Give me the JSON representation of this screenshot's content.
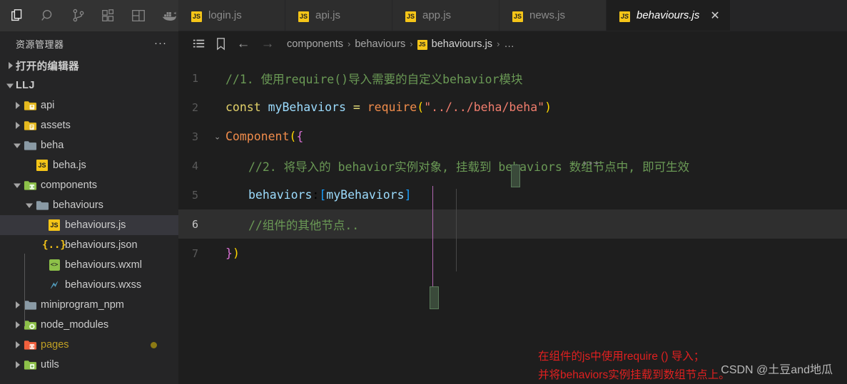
{
  "activity_bar": {
    "items": [
      {
        "name": "explorer-icon",
        "label": "资源管理器",
        "active": true
      },
      {
        "name": "search-icon",
        "label": "搜索",
        "active": false
      },
      {
        "name": "source-control-icon",
        "label": "源代码管理",
        "active": false
      },
      {
        "name": "extensions-icon",
        "label": "扩展",
        "active": false
      },
      {
        "name": "layout-icon",
        "label": "布局",
        "active": false
      },
      {
        "name": "docker-icon",
        "label": "Docker",
        "active": false
      }
    ]
  },
  "sidebar": {
    "title": "资源管理器",
    "more_actions": "···",
    "items": [
      {
        "label": "打开的编辑器",
        "kind": "section",
        "twisty": "collapsed",
        "depth": 0,
        "icon": "none",
        "selected": false
      },
      {
        "label": "LLJ",
        "kind": "section",
        "twisty": "expanded",
        "depth": 0,
        "icon": "none",
        "selected": false
      },
      {
        "label": "api",
        "kind": "folder",
        "twisty": "collapsed",
        "depth": 1,
        "icon": "folder-api",
        "selected": false
      },
      {
        "label": "assets",
        "kind": "folder",
        "twisty": "collapsed",
        "depth": 1,
        "icon": "folder-assets",
        "selected": false
      },
      {
        "label": "beha",
        "kind": "folder",
        "twisty": "expanded",
        "depth": 1,
        "icon": "folder-plain",
        "selected": false
      },
      {
        "label": "beha.js",
        "kind": "file",
        "twisty": "none",
        "depth": 2,
        "icon": "js-icon",
        "selected": false
      },
      {
        "label": "components",
        "kind": "folder",
        "twisty": "expanded",
        "depth": 1,
        "icon": "folder-components",
        "selected": false
      },
      {
        "label": "behaviours",
        "kind": "folder",
        "twisty": "expanded",
        "depth": 2,
        "icon": "folder-plain",
        "selected": false
      },
      {
        "label": "behaviours.js",
        "kind": "file",
        "twisty": "none",
        "depth": 3,
        "icon": "js-icon",
        "selected": true
      },
      {
        "label": "behaviours.json",
        "kind": "file",
        "twisty": "none",
        "depth": 3,
        "icon": "json-icon",
        "selected": false
      },
      {
        "label": "behaviours.wxml",
        "kind": "file",
        "twisty": "none",
        "depth": 3,
        "icon": "wxml-icon",
        "selected": false
      },
      {
        "label": "behaviours.wxss",
        "kind": "file",
        "twisty": "none",
        "depth": 3,
        "icon": "wxss-icon",
        "selected": false
      },
      {
        "label": "miniprogram_npm",
        "kind": "folder",
        "twisty": "collapsed",
        "depth": 1,
        "icon": "folder-grey",
        "selected": false
      },
      {
        "label": "node_modules",
        "kind": "folder",
        "twisty": "collapsed",
        "depth": 1,
        "icon": "folder-node",
        "selected": false
      },
      {
        "label": "pages",
        "kind": "folder",
        "twisty": "collapsed",
        "depth": 1,
        "icon": "folder-pages",
        "selected": false,
        "badge": true,
        "dirty": true
      },
      {
        "label": "utils",
        "kind": "folder",
        "twisty": "collapsed",
        "depth": 1,
        "icon": "folder-utils",
        "selected": false
      }
    ]
  },
  "tabs": [
    {
      "label": "login.js",
      "icon": "js-icon",
      "active": false,
      "closable": false
    },
    {
      "label": "api.js",
      "icon": "js-icon",
      "active": false,
      "closable": false
    },
    {
      "label": "app.js",
      "icon": "js-icon",
      "active": false,
      "closable": false
    },
    {
      "label": "news.js",
      "icon": "js-icon",
      "active": false,
      "closable": false
    },
    {
      "label": "behaviours.js",
      "icon": "js-icon",
      "active": true,
      "closable": true,
      "close_glyph": "✕"
    }
  ],
  "breadcrumb": {
    "toolbar": [
      {
        "name": "outline-icon",
        "glyph": "list"
      },
      {
        "name": "bookmark-icon",
        "glyph": "bookmark"
      }
    ],
    "nav_back": "←",
    "nav_forward": "→",
    "separator": "›",
    "crumbs": [
      {
        "label": "components",
        "icon": "none",
        "lit": false
      },
      {
        "label": "behaviours",
        "icon": "none",
        "lit": false
      },
      {
        "label": "behaviours.js",
        "icon": "js-icon",
        "lit": true
      },
      {
        "label": "…",
        "icon": "none",
        "lit": false
      }
    ]
  },
  "editor": {
    "lines": [
      {
        "n": "1",
        "current": false,
        "fold": "",
        "indent": 0,
        "tokens": [
          {
            "t": "//1. 使用require()导入需要的自定义behavior模块",
            "c": "cmt"
          }
        ]
      },
      {
        "n": "2",
        "current": false,
        "fold": "",
        "indent": 0,
        "tokens": [
          {
            "t": "const",
            "c": "kw"
          },
          {
            "t": " ",
            "c": "plain"
          },
          {
            "t": "myBehaviors",
            "c": "var"
          },
          {
            "t": " ",
            "c": "plain"
          },
          {
            "t": "=",
            "c": "op"
          },
          {
            "t": " ",
            "c": "plain"
          },
          {
            "t": "require",
            "c": "fn"
          },
          {
            "t": "(",
            "c": "br-yellow"
          },
          {
            "t": "\"../../beha/beha\"",
            "c": "str"
          },
          {
            "t": ")",
            "c": "br-yellow"
          }
        ]
      },
      {
        "n": "3",
        "current": false,
        "fold": "⌄",
        "indent": 0,
        "tokens": [
          {
            "t": "Component",
            "c": "id"
          },
          {
            "t": "(",
            "c": "br-yellow"
          },
          {
            "t": "{",
            "c": "br-pink"
          }
        ]
      },
      {
        "n": "4",
        "current": false,
        "fold": "",
        "indent": 1,
        "tokens": [
          {
            "t": "//2. 将导入的 behavior实例对象, 挂载到 behaviors 数组节点中, 即可生效",
            "c": "cmt"
          }
        ]
      },
      {
        "n": "5",
        "current": false,
        "fold": "",
        "indent": 1,
        "tokens": [
          {
            "t": "behaviors",
            "c": "prop"
          },
          {
            "t": ":",
            "c": "plain"
          },
          {
            "t": "[",
            "c": "brk-blue"
          },
          {
            "t": "myBehaviors",
            "c": "var"
          },
          {
            "t": "]",
            "c": "brk-blue"
          }
        ]
      },
      {
        "n": "6",
        "current": true,
        "fold": "",
        "indent": 1,
        "tokens": [
          {
            "t": "//组件的其他节点..",
            "c": "cmt"
          }
        ]
      },
      {
        "n": "7",
        "current": false,
        "fold": "",
        "indent": 0,
        "tokens": [
          {
            "t": "}",
            "c": "br-pink"
          },
          {
            "t": ")",
            "c": "br-yellow"
          }
        ]
      }
    ],
    "inlay_hint": "•••"
  },
  "annotation": {
    "line1": "在组件的js中使用require () 导入；",
    "line2": "并将behaviors实例挂载到数组节点上。",
    "color": "#e02020"
  },
  "watermark": "CSDN @土豆and地瓜",
  "theme": {
    "activity_bar_bg": "#333333",
    "sidebar_bg": "#252526",
    "editor_bg": "#1e1e1e",
    "tab_inactive_bg": "#2d2d2d",
    "selection_bg": "#37373d",
    "comment_green": "#6a9955",
    "string_salmon": "#f07d6d",
    "keyword_yellow": "#e3d26a",
    "function_orange": "#f08c4b",
    "variable_blue": "#9cdcfe"
  }
}
